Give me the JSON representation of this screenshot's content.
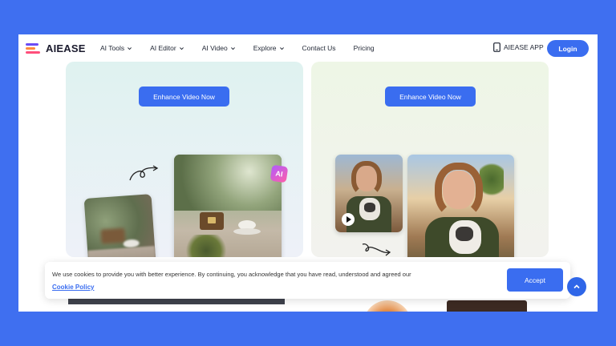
{
  "brand": {
    "name": "AIEASE",
    "logo_colors": [
      "#6b4cf6",
      "#ff8a3d",
      "#ff4f7b"
    ]
  },
  "nav": {
    "items": [
      {
        "label": "AI Tools",
        "has_dropdown": true
      },
      {
        "label": "AI Editor",
        "has_dropdown": true
      },
      {
        "label": "AI Video",
        "has_dropdown": true
      },
      {
        "label": "Explore",
        "has_dropdown": true
      },
      {
        "label": "Contact Us",
        "has_dropdown": false
      },
      {
        "label": "Pricing",
        "has_dropdown": false
      }
    ],
    "app_label": "AIEASE APP",
    "login_label": "Login"
  },
  "panels": {
    "left": {
      "cta_label": "Enhance Video Now",
      "ai_badge": "AI"
    },
    "right": {
      "cta_label": "Enhance Video Now"
    }
  },
  "cookie": {
    "text": "We use cookies to provide you with better experience. By continuing, you acknowledge that you have read, understood and agreed our",
    "link_label": "Cookie Policy",
    "accept_label": "Accept"
  },
  "colors": {
    "accent": "#3a6df0",
    "page_bg": "#3f6ff0"
  },
  "icons": [
    "chevron-down-icon",
    "phone-icon",
    "play-icon",
    "curved-arrow-icon",
    "arrow-up-icon"
  ]
}
